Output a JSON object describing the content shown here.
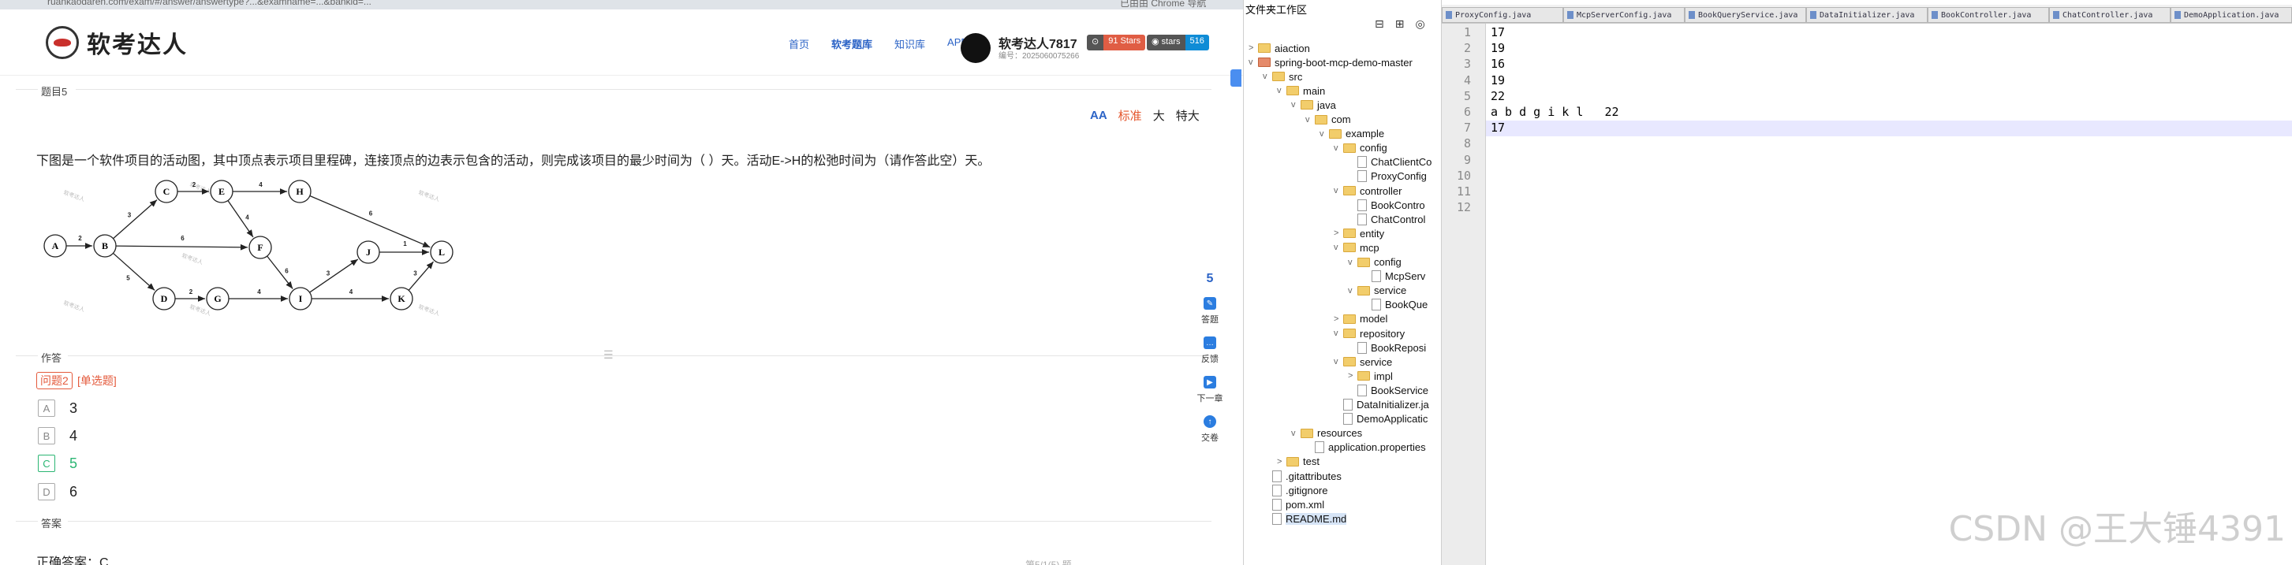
{
  "browser": {
    "url": "ruankaodaren.com/exam/#/answer/answertype?...&examname=...&bankid=...",
    "extension_text": "已由由 Chrome 导航"
  },
  "site": {
    "logo_text": "软考达人",
    "nav": [
      "首页",
      "软考题库",
      "知识库",
      "APP"
    ],
    "nav_active": "软考题库",
    "user_name": "软考达人7817",
    "user_sub": "编号：2025060075266",
    "badges": [
      {
        "left": "⊙",
        "right": "91 Stars",
        "color": "#e05d44"
      },
      {
        "left": "◉ stars",
        "right": "516",
        "color": "#0f8cd6"
      }
    ]
  },
  "question": {
    "section": "题目5",
    "font_options": [
      "标准",
      "大",
      "特大"
    ],
    "font_active": "标准",
    "text": "下图是一个软件项目的活动图，其中顶点表示项目里程碑，连接顶点的边表示包含的活动，则完成该项目的最少时间为（ ）天。活动E->H的松弛时间为（请作答此空）天。",
    "watermark": "软考达人",
    "graph": {
      "nodes": [
        "A",
        "B",
        "C",
        "D",
        "E",
        "F",
        "G",
        "H",
        "I",
        "J",
        "K",
        "L"
      ],
      "edge_weights": [
        "2",
        "3",
        "6",
        "5",
        "2",
        "4",
        "4",
        "6",
        "4",
        "6",
        "2",
        "4",
        "3",
        "3",
        "1"
      ]
    },
    "work_label": "作答",
    "tag_num": "问题2",
    "tag_type": "[单选题]",
    "options": [
      {
        "letter": "A",
        "value": "3"
      },
      {
        "letter": "B",
        "value": "4"
      },
      {
        "letter": "C",
        "value": "5"
      },
      {
        "letter": "D",
        "value": "6"
      }
    ],
    "answer_label": "答案",
    "answer_text": "正确答案：C",
    "bottom_text": "第5/1(5) 题"
  },
  "sidetools": {
    "number": "5",
    "items": [
      {
        "label": "答题",
        "icon": "answer-icon"
      },
      {
        "label": "反馈",
        "icon": "feedback-icon"
      },
      {
        "label": "下一章",
        "icon": "next-icon"
      },
      {
        "label": "交卷",
        "icon": "submit-icon"
      }
    ]
  },
  "tree": {
    "title": "文件夹工作区",
    "items": [
      {
        "label": "aiaction",
        "type": "folder",
        "depth": 0,
        "arrow": ">"
      },
      {
        "label": "spring-boot-mcp-demo-master",
        "type": "project",
        "depth": 0,
        "arrow": "v"
      },
      {
        "label": "src",
        "type": "folder",
        "depth": 1,
        "arrow": "v"
      },
      {
        "label": "main",
        "type": "folder",
        "depth": 2,
        "arrow": "v"
      },
      {
        "label": "java",
        "type": "folder",
        "depth": 3,
        "arrow": "v"
      },
      {
        "label": "com",
        "type": "folder",
        "depth": 4,
        "arrow": "v"
      },
      {
        "label": "example",
        "type": "folder",
        "depth": 5,
        "arrow": "v"
      },
      {
        "label": "config",
        "type": "folder",
        "depth": 6,
        "arrow": "v"
      },
      {
        "label": "ChatClientCo",
        "type": "file",
        "depth": 7,
        "arrow": ""
      },
      {
        "label": "ProxyConfig",
        "type": "file",
        "depth": 7,
        "arrow": ""
      },
      {
        "label": "controller",
        "type": "folder",
        "depth": 6,
        "arrow": "v"
      },
      {
        "label": "BookContro",
        "type": "file",
        "depth": 7,
        "arrow": ""
      },
      {
        "label": "ChatControl",
        "type": "file",
        "depth": 7,
        "arrow": ""
      },
      {
        "label": "entity",
        "type": "folder",
        "depth": 6,
        "arrow": ">"
      },
      {
        "label": "mcp",
        "type": "folder",
        "depth": 6,
        "arrow": "v"
      },
      {
        "label": "config",
        "type": "folder",
        "depth": 7,
        "arrow": "v"
      },
      {
        "label": "McpServ",
        "type": "file",
        "depth": 8,
        "arrow": ""
      },
      {
        "label": "service",
        "type": "folder",
        "depth": 7,
        "arrow": "v"
      },
      {
        "label": "BookQue",
        "type": "file",
        "depth": 8,
        "arrow": ""
      },
      {
        "label": "model",
        "type": "folder",
        "depth": 6,
        "arrow": ">"
      },
      {
        "label": "repository",
        "type": "folder",
        "depth": 6,
        "arrow": "v"
      },
      {
        "label": "BookReposi",
        "type": "file",
        "depth": 7,
        "arrow": ""
      },
      {
        "label": "service",
        "type": "folder",
        "depth": 6,
        "arrow": "v"
      },
      {
        "label": "impl",
        "type": "folder",
        "depth": 7,
        "arrow": ">"
      },
      {
        "label": "BookService",
        "type": "file",
        "depth": 7,
        "arrow": ""
      },
      {
        "label": "DataInitializer.ja",
        "type": "file",
        "depth": 6,
        "arrow": ""
      },
      {
        "label": "DemoApplicatic",
        "type": "file",
        "depth": 6,
        "arrow": ""
      },
      {
        "label": "resources",
        "type": "folder",
        "depth": 3,
        "arrow": "v"
      },
      {
        "label": "application.properties",
        "type": "file",
        "depth": 4,
        "arrow": ""
      },
      {
        "label": "test",
        "type": "folder",
        "depth": 2,
        "arrow": ">"
      },
      {
        "label": ".gitattributes",
        "type": "file",
        "depth": 1,
        "arrow": ""
      },
      {
        "label": ".gitignore",
        "type": "file",
        "depth": 1,
        "arrow": ""
      },
      {
        "label": "pom.xml",
        "type": "file",
        "depth": 1,
        "arrow": ""
      },
      {
        "label": "README.md",
        "type": "file",
        "depth": 1,
        "arrow": "",
        "selected": true
      }
    ]
  },
  "editor": {
    "tabs": [
      "ProxyConfig.java",
      "McpServerConfig.java",
      "BookQueryService.java",
      "DataInitializer.java",
      "BookController.java",
      "ChatController.java",
      "DemoApplication.java"
    ],
    "lines": [
      "17",
      "19",
      "16",
      "19",
      "22",
      "a b d g i k l   22",
      "17",
      "",
      "",
      "",
      "",
      ""
    ],
    "active_line": 7,
    "watermark": "CSDN @王大锤4391"
  }
}
